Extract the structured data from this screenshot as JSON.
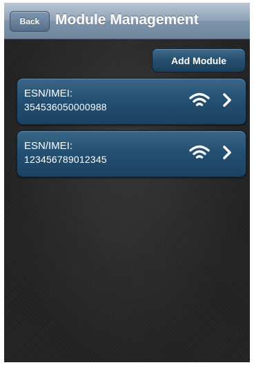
{
  "navbar": {
    "back_label": "Back",
    "title": "Module Management"
  },
  "toolbar": {
    "add_module_label": "Add Module"
  },
  "modules": [
    {
      "label": "ESN/IMEI:",
      "value": "354536050000988",
      "status_icon": "wifi-icon",
      "action_icon": "chevron-right-icon"
    },
    {
      "label": "ESN/IMEI:",
      "value": "123456789012345",
      "status_icon": "wifi-icon",
      "action_icon": "chevron-right-icon"
    }
  ],
  "colors": {
    "navbar": "#8fa3b7",
    "button_blue": "#245073",
    "background": "#232323"
  }
}
